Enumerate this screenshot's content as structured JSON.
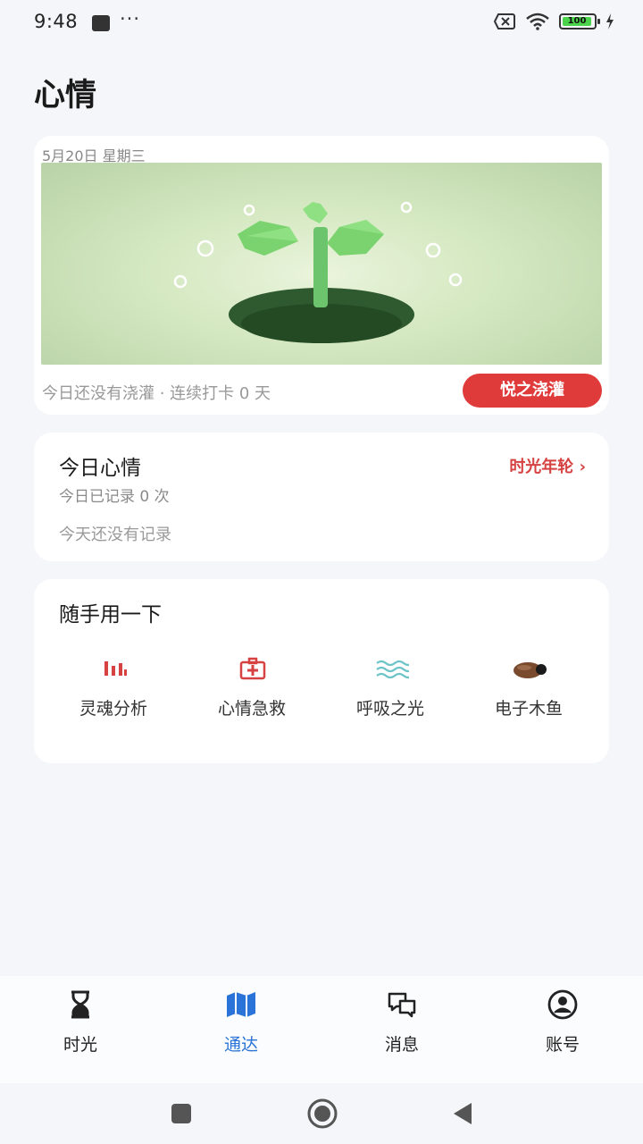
{
  "status_bar": {
    "time": "9:48",
    "dots": "···",
    "battery": "100"
  },
  "page": {
    "title": "心情"
  },
  "plant_card": {
    "date": "5月20日 星期三",
    "streak_text": "今日还没有浇灌 · 连续打卡 0 天",
    "water_button": "悦之浇灌"
  },
  "mood_card": {
    "title": "今日心情",
    "link": "时光年轮 ›",
    "count_text": "今日已记录 0 次",
    "empty_text": "今天还没有记录"
  },
  "tools_card": {
    "title": "随手用一下",
    "items": [
      {
        "label": "灵魂分析",
        "icon": "bar-chart-icon"
      },
      {
        "label": "心情急救",
        "icon": "first-aid-icon"
      },
      {
        "label": "呼吸之光",
        "icon": "waves-icon"
      },
      {
        "label": "电子木鱼",
        "icon": "wooden-fish-icon"
      }
    ]
  },
  "bottom_nav": {
    "items": [
      {
        "label": "时光",
        "icon": "hourglass-icon",
        "active": false
      },
      {
        "label": "通达",
        "icon": "map-icon",
        "active": true
      },
      {
        "label": "消息",
        "icon": "chat-icon",
        "active": false
      },
      {
        "label": "账号",
        "icon": "account-icon",
        "active": false
      }
    ]
  },
  "colors": {
    "accent_red": "#e03b3b",
    "active_blue": "#2a73d8",
    "background": "#f4f6f9"
  }
}
